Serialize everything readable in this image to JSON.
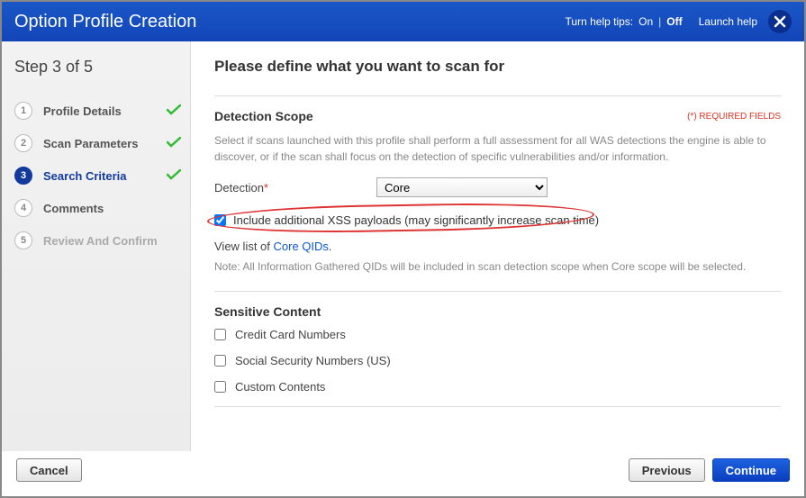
{
  "title": "Option Profile Creation",
  "help": {
    "tips_label": "Turn help tips:",
    "on": "On",
    "off": "Off",
    "launch": "Launch help"
  },
  "sidebar": {
    "step_label": "Step 3 of 5",
    "steps": [
      {
        "num": "1",
        "label": "Profile Details"
      },
      {
        "num": "2",
        "label": "Scan Parameters"
      },
      {
        "num": "3",
        "label": "Search Criteria"
      },
      {
        "num": "4",
        "label": "Comments"
      },
      {
        "num": "5",
        "label": "Review And Confirm"
      }
    ]
  },
  "main": {
    "heading": "Please define what you want to scan for",
    "required_label": "(*) REQUIRED FIELDS",
    "detection_scope": {
      "title": "Detection Scope",
      "desc": "Select if scans launched with this profile shall perform a full assessment for all WAS detections the engine is able to discover, or if the scan shall focus on the detection of specific vulnerabilities and/or information.",
      "field_label": "Detection",
      "value": "Core",
      "xss_label": "Include additional XSS payloads (may significantly increase scan time)",
      "view_prefix": "View list of ",
      "view_link": "Core QIDs",
      "note": "Note: All Information Gathered QIDs will be included in scan detection scope when Core scope will be selected."
    },
    "sensitive": {
      "title": "Sensitive Content",
      "items": [
        "Credit Card Numbers",
        "Social Security Numbers (US)",
        "Custom Contents"
      ]
    }
  },
  "footer": {
    "cancel": "Cancel",
    "previous": "Previous",
    "continue": "Continue"
  }
}
